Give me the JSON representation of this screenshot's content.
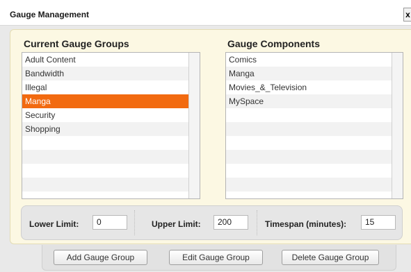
{
  "window": {
    "title": "Gauge Management",
    "close_label": "x"
  },
  "groups": {
    "heading": "Current Gauge Groups",
    "items": [
      "Adult Content",
      "Bandwidth",
      "Illegal",
      "Manga",
      "Security",
      "Shopping"
    ],
    "selected": "Manga"
  },
  "components": {
    "heading": "Gauge Components",
    "items": [
      "Comics",
      "Manga",
      "Movies_&_Television",
      "MySpace"
    ]
  },
  "limits": {
    "lower_label": "Lower Limit:",
    "lower_value": "0",
    "upper_label": "Upper Limit:",
    "upper_value": "200",
    "timespan_label": "Timespan (minutes):",
    "timespan_value": "15"
  },
  "buttons": {
    "add": "Add Gauge Group",
    "edit": "Edit Gauge Group",
    "delete": "Delete Gauge Group"
  },
  "colors": {
    "selection": "#f26a10",
    "panel_background": "#fcf8e3"
  }
}
